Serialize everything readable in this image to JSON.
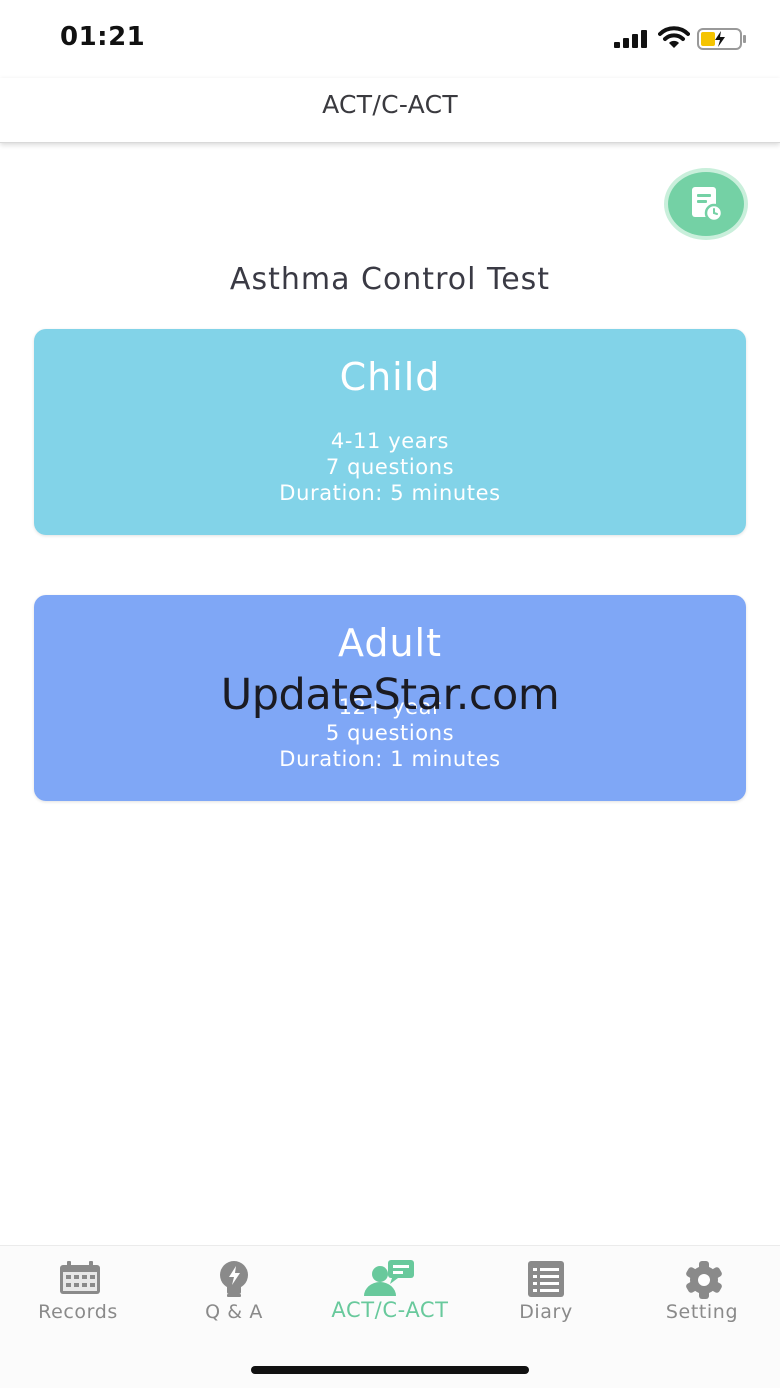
{
  "status_bar": {
    "time": "01:21"
  },
  "nav": {
    "title": "ACT/C-ACT"
  },
  "main": {
    "section_title": "Asthma Control Test",
    "cards": [
      {
        "title": "Child",
        "age": "4-11 years",
        "questions": "7 questions",
        "duration": "Duration: 5 minutes",
        "color": "#82d3e8"
      },
      {
        "title": "Adult",
        "age": "12+ year",
        "questions": "5 questions",
        "duration": "Duration: 1 minutes",
        "color": "#7fa7f6"
      }
    ]
  },
  "watermark": "UpdateStar.com",
  "tabs": [
    {
      "label": "Records",
      "icon": "calendar-icon",
      "active": false
    },
    {
      "label": "Q & A",
      "icon": "lightbulb-icon",
      "active": false
    },
    {
      "label": "ACT/C-ACT",
      "icon": "consult-icon",
      "active": true
    },
    {
      "label": "Diary",
      "icon": "list-icon",
      "active": false
    },
    {
      "label": "Setting",
      "icon": "gear-icon",
      "active": false
    }
  ],
  "colors": {
    "accent": "#68c99c",
    "inactive": "#8a8a8a",
    "history_button": "#74d1a5"
  }
}
